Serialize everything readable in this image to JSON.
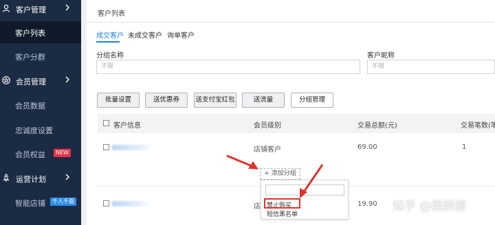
{
  "sidebar": {
    "group_customer": "客户管理",
    "items_customer": [
      "客户列表",
      "客户分群"
    ],
    "group_member": "会员管理",
    "items_member": [
      "会员数据",
      "忠诚度设置",
      "会员权益"
    ],
    "badge_new": "NEW",
    "group_ops": "运营计划",
    "items_ops": [
      "智能店铺"
    ],
    "badge_ops": "千人千面"
  },
  "page": {
    "title": "客户列表",
    "tabs": [
      "成交客户",
      "未成交客户",
      "询单客户"
    ],
    "active_tab": 0
  },
  "filters": {
    "group_label": "分组名称",
    "group_placeholder": "不限",
    "nickname_label": "客户昵称",
    "nickname_placeholder": "不限"
  },
  "actions": [
    "批量设置",
    "送优惠券",
    "送支付宝红包",
    "送流量",
    "分组管理"
  ],
  "table": {
    "columns": [
      "客户信息",
      "会员级别",
      "交易总额(元)",
      "交易笔数(笔"
    ],
    "rows": [
      {
        "level": "店铺客户",
        "amount": "69.00",
        "count": "1"
      },
      {
        "level": "店",
        "amount": "19.90",
        "count": ""
      }
    ]
  },
  "add_group": "+ 添加分组",
  "dropdown": {
    "search_placeholder": "",
    "items": [
      "禁止购买",
      "短信黑名单"
    ],
    "highlighted": 0
  },
  "watermark": "知乎 @照顾酱",
  "colors": {
    "sidebar_bg": "#1b2b43",
    "accent_blue": "#1f80e0",
    "annotation_red": "#e0322b",
    "badge_red": "#e8334a",
    "badge_blue": "#2e8ee8"
  }
}
